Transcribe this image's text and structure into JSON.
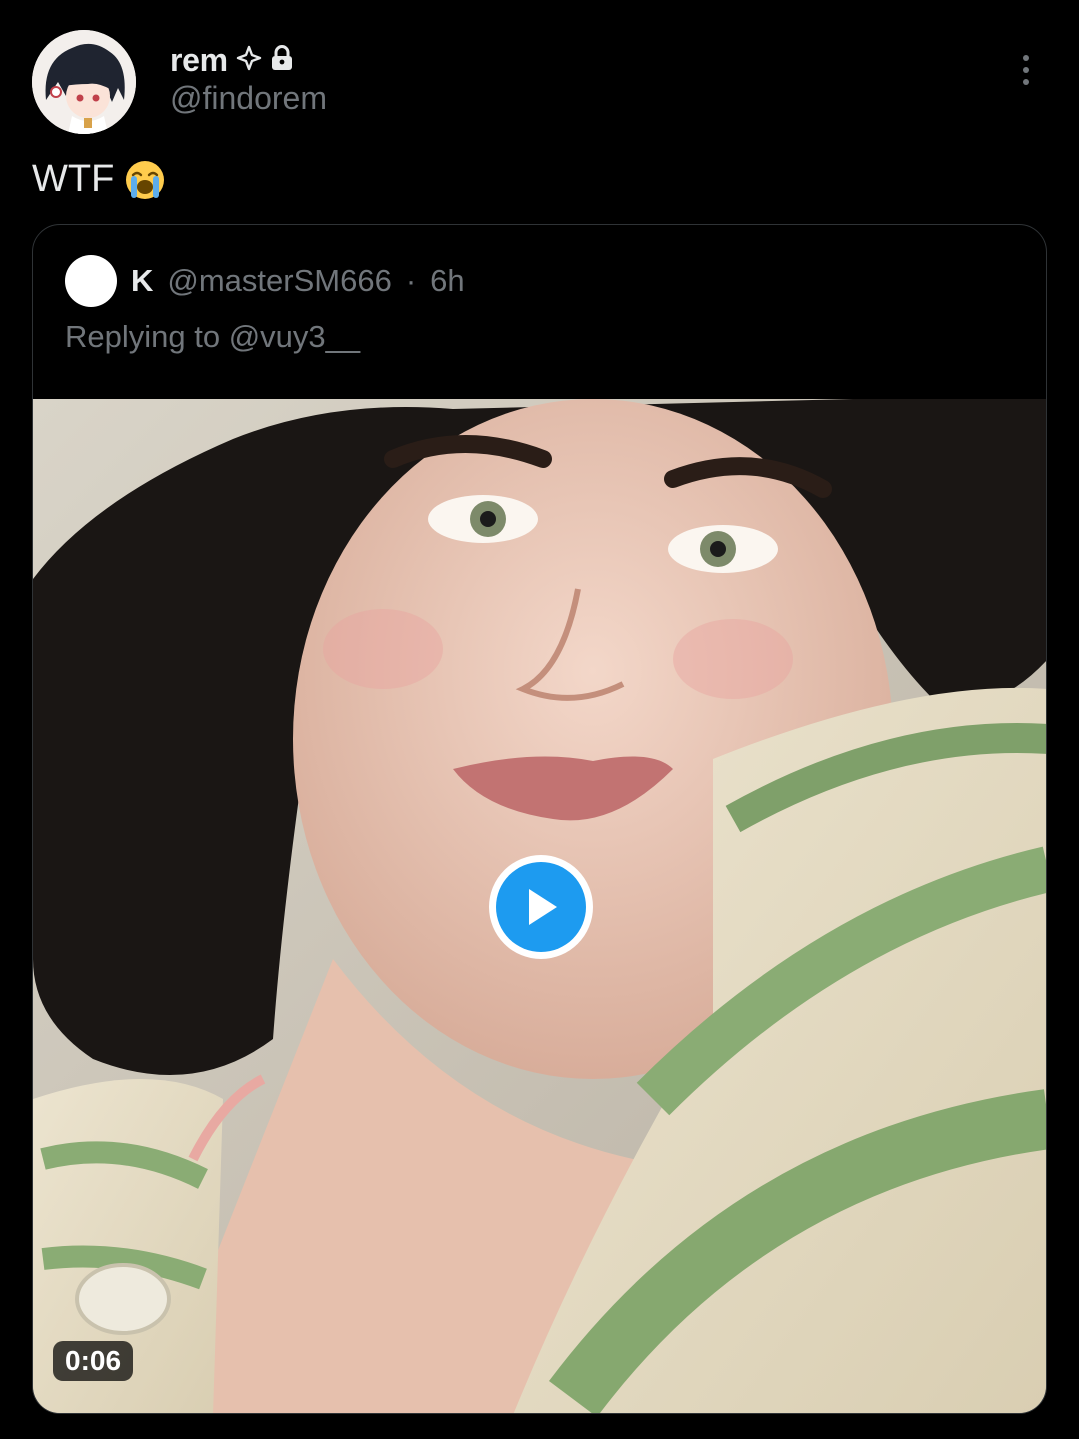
{
  "author": {
    "display_name": "rem",
    "handle": "@findorem",
    "badges": [
      "sparkle-outline-icon",
      "lock-icon"
    ]
  },
  "more_menu": {
    "icon": "more-vertical-icon"
  },
  "tweet": {
    "text": "WTF",
    "emoji": "loudly-crying-face"
  },
  "quoted_tweet": {
    "display_name": "K",
    "handle": "@masterSM666",
    "separator": "·",
    "time": "6h",
    "replying_to": "Replying to @vuy3__",
    "media": {
      "type": "video",
      "duration": "0:06",
      "play_icon": "play-icon"
    }
  },
  "colors": {
    "background": "#000000",
    "text_primary": "#e7e9ea",
    "text_secondary": "#71767b",
    "border": "#2f3336",
    "accent": "#1d9bf0"
  }
}
